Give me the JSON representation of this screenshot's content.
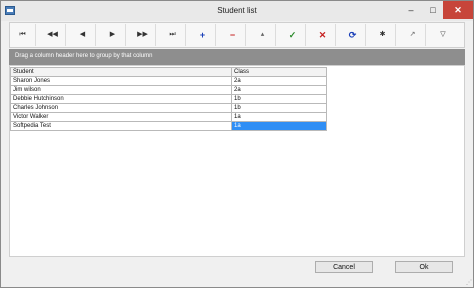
{
  "window": {
    "title": "Student list",
    "minimize_glyph": "–",
    "maximize_glyph": "□",
    "close_glyph": "✕"
  },
  "toolbar": {
    "buttons": [
      {
        "name": "first-record-icon",
        "glyph": "⏮"
      },
      {
        "name": "prior-page-icon",
        "glyph": "◀◀"
      },
      {
        "name": "prior-record-icon",
        "glyph": "◀"
      },
      {
        "name": "next-record-icon",
        "glyph": "▶"
      },
      {
        "name": "next-page-icon",
        "glyph": "▶▶"
      },
      {
        "name": "last-record-icon",
        "glyph": "⏭"
      },
      {
        "name": "insert-icon",
        "glyph": "+"
      },
      {
        "name": "delete-icon",
        "glyph": "−"
      },
      {
        "name": "edit-icon",
        "glyph": "▴"
      },
      {
        "name": "post-icon",
        "glyph": "✓"
      },
      {
        "name": "cancel-edit-icon",
        "glyph": "✕"
      },
      {
        "name": "refresh-icon",
        "glyph": "⟳"
      },
      {
        "name": "save-bookmark-icon",
        "glyph": "✱"
      },
      {
        "name": "goto-bookmark-icon",
        "glyph": "↗"
      },
      {
        "name": "filter-icon",
        "glyph": "▽"
      }
    ]
  },
  "group_panel": {
    "text": "Drag a column header here to group by that column"
  },
  "grid": {
    "columns": [
      "Student",
      "Class"
    ],
    "rows": [
      {
        "student": "Sharon Jones",
        "class": "2a"
      },
      {
        "student": "Jim wilson",
        "class": "2a"
      },
      {
        "student": "Debbie Hutchinson",
        "class": "1b"
      },
      {
        "student": "Charles Johnson",
        "class": "1b"
      },
      {
        "student": "Victor Walker",
        "class": "1a"
      },
      {
        "student": "Softpedia Test",
        "class": "1a"
      }
    ],
    "selected_row": 5
  },
  "footer": {
    "cancel_label": "Cancel",
    "ok_label": "Ok"
  },
  "colors": {
    "selection": "#2f8ef5",
    "group_panel": "#8e8e8e",
    "close_button": "#c7453a"
  }
}
